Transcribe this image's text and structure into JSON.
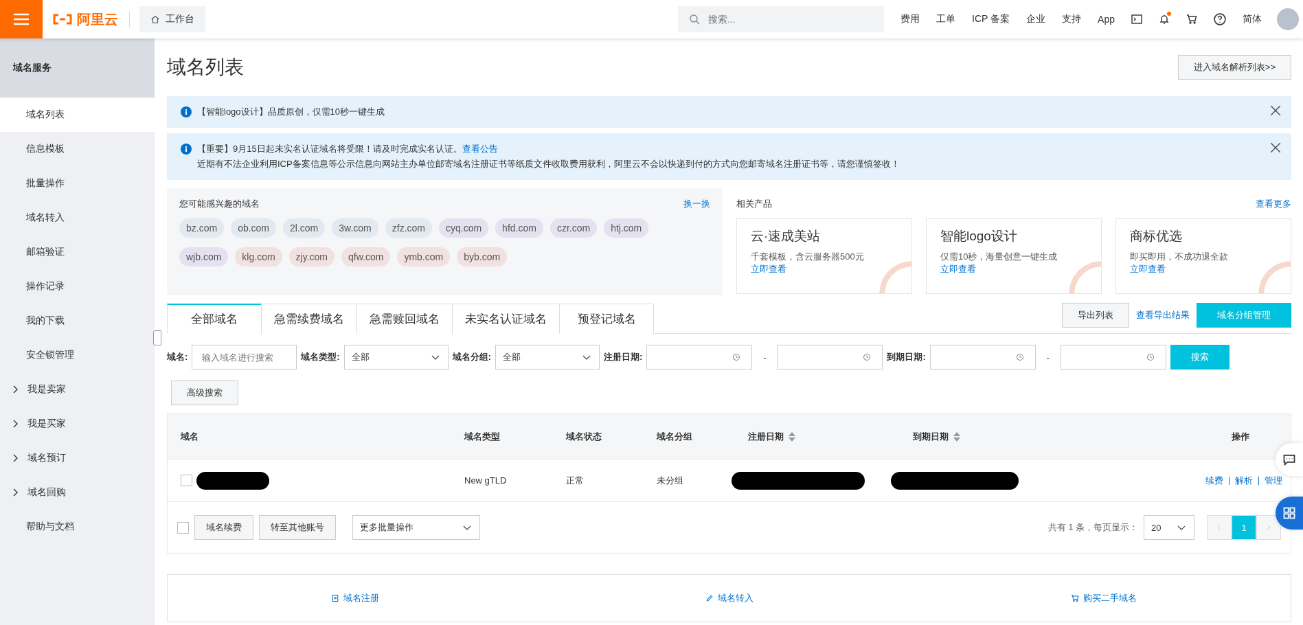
{
  "topbar": {
    "logo": "阿里云",
    "workbench": "工作台",
    "search": {
      "placeholder": "搜索..."
    },
    "links": [
      "费用",
      "工单",
      "ICP 备案",
      "企业",
      "支持",
      "App"
    ],
    "language": "简体"
  },
  "sidebar": {
    "title": "域名服务",
    "items": [
      {
        "label": "域名列表",
        "kind": "link",
        "selected": true
      },
      {
        "label": "信息模板",
        "kind": "link",
        "selected": false
      },
      {
        "label": "批量操作",
        "kind": "link",
        "selected": false
      },
      {
        "label": "域名转入",
        "kind": "link",
        "selected": false
      },
      {
        "label": "邮箱验证",
        "kind": "link",
        "selected": false
      },
      {
        "label": "操作记录",
        "kind": "link",
        "selected": false
      },
      {
        "label": "我的下载",
        "kind": "link",
        "selected": false
      },
      {
        "label": "安全锁管理",
        "kind": "link",
        "selected": false
      },
      {
        "label": "我是卖家",
        "kind": "group",
        "selected": false,
        "expanded": false
      },
      {
        "label": "我是买家",
        "kind": "group",
        "selected": false,
        "expanded": false
      },
      {
        "label": "域名预订",
        "kind": "group",
        "selected": false,
        "expanded": false
      },
      {
        "label": "域名回购",
        "kind": "group",
        "selected": false,
        "expanded": false
      },
      {
        "label": "帮助与文档",
        "kind": "link",
        "selected": false
      }
    ]
  },
  "header": {
    "title": "域名列表",
    "button": "进入域名解析列表>>"
  },
  "notices": [
    {
      "text": "【智能logo设计】品质原创，仅需10秒一键生成"
    },
    {
      "text": "【重要】9月15日起未实名认证域名将受限！请及时完成实名认证。",
      "link": "查看公告",
      "detail": "近期有不法企业利用ICP备案信息等公示信息向网站主办单位邮寄域名注册证书等纸质文件收取费用获利，阿里云不会以快递到付的方式向您邮寄域名注册证书等，请您谨慎签收！"
    }
  ],
  "suggestions": {
    "title": "您可能感兴趣的域名",
    "refresh": "换一换",
    "domains": [
      {
        "name": "bz.com",
        "color": "#e3e9f0"
      },
      {
        "name": "ob.com",
        "color": "#e3e9f0"
      },
      {
        "name": "2l.com",
        "color": "#e3e9f0"
      },
      {
        "name": "3w.com",
        "color": "#e3e9f0"
      },
      {
        "name": "zfz.com",
        "color": "#e3e9f0"
      },
      {
        "name": "cyq.com",
        "color": "#e6e1f0"
      },
      {
        "name": "hfd.com",
        "color": "#e6e1f0"
      },
      {
        "name": "czr.com",
        "color": "#e6e1f0"
      },
      {
        "name": "htj.com",
        "color": "#e6e1f0"
      },
      {
        "name": "wjb.com",
        "color": "#e6e1f0"
      },
      {
        "name": "klg.com",
        "color": "#f2e1e1"
      },
      {
        "name": "zjy.com",
        "color": "#f2e1e1"
      },
      {
        "name": "qfw.com",
        "color": "#f2e1e1"
      },
      {
        "name": "ymb.com",
        "color": "#f2e1e1"
      },
      {
        "name": "byb.com",
        "color": "#f2e1e1"
      }
    ]
  },
  "products": {
    "title": "相关产品",
    "more": "查看更多",
    "items": [
      {
        "name": "云·速成美站",
        "desc": "千套模板，含云服务器500元",
        "link": "立即查看"
      },
      {
        "name": "智能logo设计",
        "desc": "仅需10秒，海量创意一键生成",
        "link": "立即查看"
      },
      {
        "name": "商标优选",
        "desc": "即买即用，不成功退全款",
        "link": "立即查看"
      }
    ]
  },
  "tabs": [
    {
      "label": "全部域名",
      "selected": true
    },
    {
      "label": "急需续费域名",
      "selected": false
    },
    {
      "label": "急需赎回域名",
      "selected": false
    },
    {
      "label": "未实名认证域名",
      "selected": false
    },
    {
      "label": "预登记域名",
      "selected": false
    }
  ],
  "actions": {
    "export": "导出列表",
    "view_export": "查看导出结果",
    "group_manage": "域名分组管理"
  },
  "filters": {
    "domain_label": "域名:",
    "domain_placeholder": "输入域名进行搜索",
    "type_label": "域名类型:",
    "type_value": "全部",
    "group_label": "域名分组:",
    "group_value": "全部",
    "reg_label": "注册日期:",
    "exp_label": "到期日期:",
    "range_sep": [
      "-",
      "-"
    ],
    "search": "搜索",
    "advanced": "高级搜索"
  },
  "table": {
    "columns": [
      {
        "label": "域名",
        "sortable": false
      },
      {
        "label": "域名类型",
        "sortable": false
      },
      {
        "label": "域名状态",
        "sortable": false
      },
      {
        "label": "域名分组",
        "sortable": false
      },
      {
        "label": "注册日期",
        "sortable": true
      },
      {
        "label": "到期日期",
        "sortable": true
      },
      {
        "label": "操作",
        "sortable": false
      }
    ],
    "rows": [
      {
        "checked": false,
        "type": "New gTLD",
        "status": "正常",
        "group": "未分组",
        "actions": [
          "续费",
          "解析",
          "管理"
        ]
      }
    ]
  },
  "footer": {
    "checked": false,
    "buttons": [
      "域名续费",
      "转至其他账号"
    ],
    "batch": "更多批量操作",
    "summary": "共有 1 条，每页显示：",
    "page_size": "20",
    "pages": [
      {
        "label": "1",
        "selected": true
      }
    ]
  },
  "shortcuts": [
    {
      "label": "域名注册",
      "kind": "register"
    },
    {
      "label": "域名转入",
      "kind": "transfer"
    },
    {
      "label": "购买二手域名",
      "kind": "buy"
    }
  ]
}
